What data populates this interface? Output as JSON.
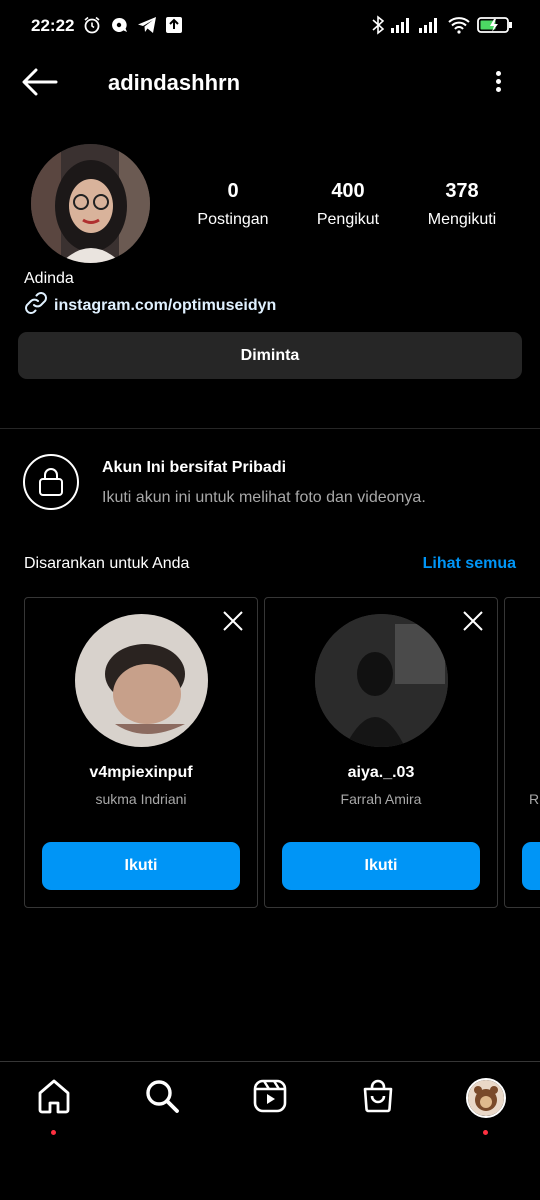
{
  "status_bar": {
    "time": "22:22",
    "left_icons": [
      "alarm-icon",
      "notification-bubble-icon",
      "telegram-icon",
      "upload-icon"
    ],
    "right_icons": [
      "bluetooth-icon",
      "signal-icon",
      "signal-icon",
      "wifi-icon",
      "battery-charging-icon"
    ]
  },
  "header": {
    "username": "adindashhrn",
    "back_icon": "arrow-left-icon",
    "menu_icon": "more-vertical-icon"
  },
  "profile": {
    "stats": [
      {
        "value": "0",
        "label": "Postingan"
      },
      {
        "value": "400",
        "label": "Pengikut"
      },
      {
        "value": "378",
        "label": "Mengikuti"
      }
    ],
    "display_name": "Adinda",
    "link": "instagram.com/optimuseidyn",
    "requested_label": "Diminta"
  },
  "private": {
    "title": "Akun Ini bersifat Pribadi",
    "subtitle": "Ikuti akun ini untuk melihat foto dan videonya."
  },
  "suggestions": {
    "title": "Disarankan untuk Anda",
    "see_all": "Lihat semua",
    "cards": [
      {
        "username": "v4mpiexinpuf",
        "name": "sukma Indriani",
        "button": "Ikuti"
      },
      {
        "username": "aiya._.03",
        "name": "Farrah Amira",
        "button": "Ikuti"
      }
    ],
    "partial_card_initial": "R"
  },
  "bottom_nav": {
    "items": [
      "home-icon",
      "search-icon",
      "reels-icon",
      "shop-icon",
      "profile-avatar"
    ]
  },
  "colors": {
    "background": "#000000",
    "accent": "#0095f6",
    "secondary_button": "#262626",
    "muted_text": "#a8a8a8",
    "notification_dot": "#ff3040"
  }
}
